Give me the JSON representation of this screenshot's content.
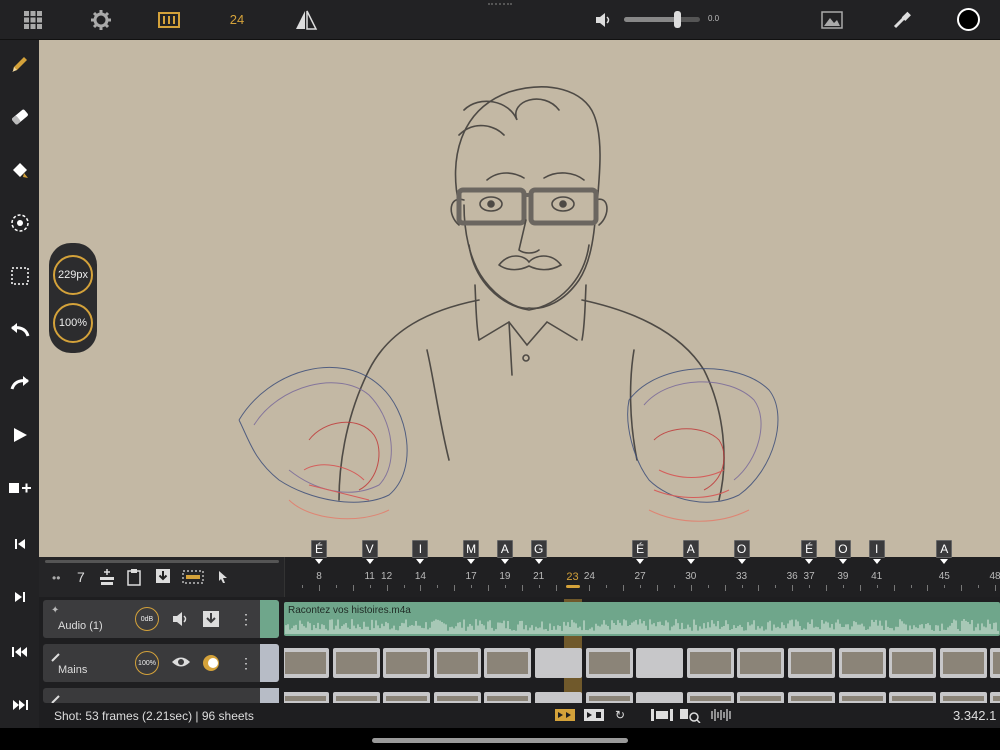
{
  "topbar": {
    "grid_icon": "grid-icon",
    "settings_icon": "gear-icon",
    "frames_icon": "film-frames-icon",
    "fps": "24",
    "mirror_icon": "flip-icon",
    "volume_icon": "speaker-icon",
    "volume_value": "0.0",
    "volume_level": 0.7,
    "reference_icon": "image-icon",
    "eyedropper_icon": "eyedropper-icon",
    "current_color": "#000000"
  },
  "sidebar": {
    "tools": [
      "pencil-icon",
      "eraser-icon",
      "fill-bucket-icon",
      "smudge-icon",
      "selection-icon",
      "undo-icon",
      "redo-icon",
      "play-icon",
      "add-frame-icon",
      "first-frame-icon",
      "last-frame-icon",
      "prev-keyframe-icon",
      "next-keyframe-icon"
    ]
  },
  "brush_panel": {
    "size": "229px",
    "opacity": "100%"
  },
  "timeline": {
    "onion_count": "7",
    "current_frame": "23",
    "frame_numbers": [
      {
        "n": "8",
        "f": 8
      },
      {
        "n": "11",
        "f": 11
      },
      {
        "n": "12",
        "f": 12
      },
      {
        "n": "14",
        "f": 14
      },
      {
        "n": "17",
        "f": 17
      },
      {
        "n": "19",
        "f": 19
      },
      {
        "n": "21",
        "f": 21
      },
      {
        "n": "23",
        "f": 23
      },
      {
        "n": "24",
        "f": 24
      },
      {
        "n": "27",
        "f": 27
      },
      {
        "n": "30",
        "f": 30
      },
      {
        "n": "33",
        "f": 33
      },
      {
        "n": "36",
        "f": 36
      },
      {
        "n": "37",
        "f": 37
      },
      {
        "n": "39",
        "f": 39
      },
      {
        "n": "41",
        "f": 41
      },
      {
        "n": "45",
        "f": 45
      },
      {
        "n": "48",
        "f": 48
      }
    ],
    "markers": [
      {
        "label": "É",
        "f": 8
      },
      {
        "label": "V",
        "f": 11
      },
      {
        "label": "I",
        "f": 14
      },
      {
        "label": "M",
        "f": 17
      },
      {
        "label": "A",
        "f": 19
      },
      {
        "label": "G",
        "f": 21
      },
      {
        "label": "É",
        "f": 27
      },
      {
        "label": "A",
        "f": 30
      },
      {
        "label": "O",
        "f": 33
      },
      {
        "label": "É",
        "f": 37
      },
      {
        "label": "O",
        "f": 39
      },
      {
        "label": "I",
        "f": 41
      },
      {
        "label": "A",
        "f": 45
      }
    ],
    "tracks": {
      "audio": {
        "name": "Audio (1)",
        "gain": "0dB",
        "file": "Racontez vos histoires.m4a"
      },
      "mains": {
        "name": "Mains",
        "opacity": "100%"
      }
    }
  },
  "status": {
    "shot_info": "Shot: 53 frames (2.21sec) | 96 sheets",
    "zoom": "3.342.1"
  },
  "colors": {
    "accent": "#d4a23a",
    "canvas_bg": "#c3b8a4",
    "audio_green": "#6fa68b"
  }
}
